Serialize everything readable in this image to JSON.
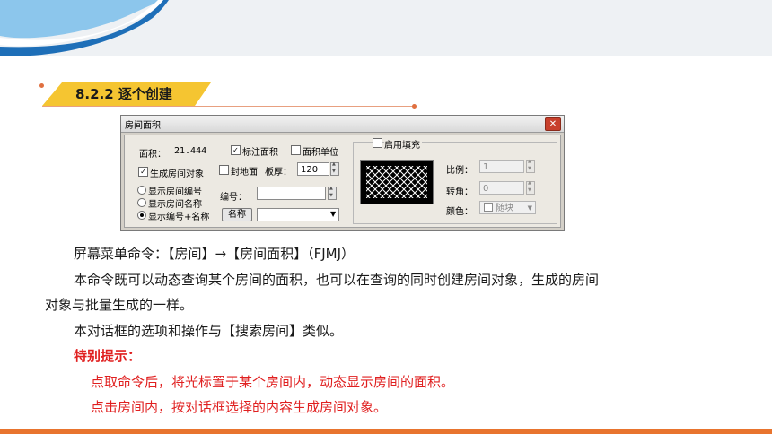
{
  "section": {
    "title": "8.2.2 逐个创建"
  },
  "dialog": {
    "title": "房间面积",
    "close_icon": "close-icon",
    "area_label": "面积：",
    "area_value": "21.444",
    "mark_area_label": "标注面积",
    "mark_area_checked": true,
    "area_unit_label": "面积单位",
    "area_unit_checked": false,
    "create_room_label": "生成房间对象",
    "create_room_checked": true,
    "seal_floor_label": "封地面",
    "seal_floor_checked": false,
    "slab_thickness_label": "板厚：",
    "slab_thickness_value": "120",
    "radio_options": [
      {
        "label": "显示房间编号",
        "selected": false
      },
      {
        "label": "显示房间名称",
        "selected": false
      },
      {
        "label": "显示编号+名称",
        "selected": true
      }
    ],
    "number_label": "编号：",
    "number_value": "",
    "name_button_label": "名称",
    "name_value": "",
    "fill_enable_label": "启用填充",
    "fill_enable_checked": false,
    "scale_label": "比例：",
    "scale_value": "1",
    "rotation_label": "转角：",
    "rotation_value": "0",
    "color_label": "颜色：",
    "color_value": "随块"
  },
  "body_text": {
    "command_line": "屏幕菜单命令：【房间】→【房间面积】（FJMJ）",
    "desc_line1": "本命令既可以动态查询某个房间的面积，也可以在查询的同时创建房间对象，生成的房间",
    "desc_line2": "对象与批量生成的一样。",
    "desc_line3": "本对话框的选项和操作与【搜索房间】类似。",
    "tip_title": "特别提示：",
    "tip_1": "点取命令后，将光标置于某个房间内，动态显示房间的面积。",
    "tip_2": "点击房间内，按对话框选择的内容生成房间对象。"
  },
  "colors": {
    "accent_orange": "#e8742e",
    "section_yellow": "#f5c531",
    "tip_red": "#e02020",
    "wave_blue": "#1e6fb8"
  }
}
